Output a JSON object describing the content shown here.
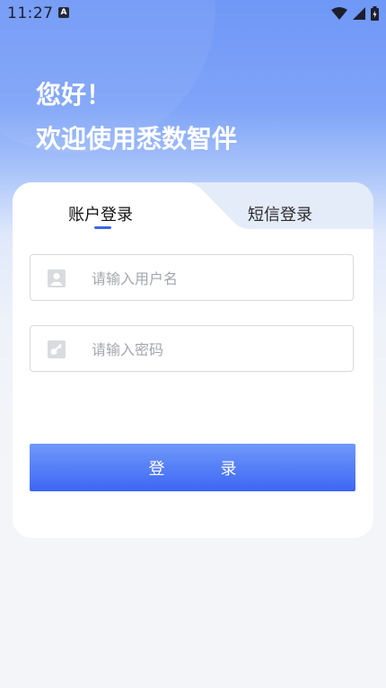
{
  "status_bar": {
    "time": "11:27",
    "notification_icon": "A"
  },
  "greeting": {
    "line1": "您好！",
    "line2": "欢迎使用悉数智伴"
  },
  "login_tabs": [
    {
      "label": "账户登录",
      "active": true
    },
    {
      "label": "短信登录",
      "active": false
    }
  ],
  "form": {
    "username_placeholder": "请输入用户名",
    "password_placeholder": "请输入密码",
    "username_icon": "user-icon",
    "password_icon": "lock-icon"
  },
  "login_button": "登　录",
  "colors": {
    "accent": "#3e67e7",
    "button_top": "#7099fb",
    "button_bottom": "#3d66f4",
    "header_blue": "#6f97f6"
  }
}
